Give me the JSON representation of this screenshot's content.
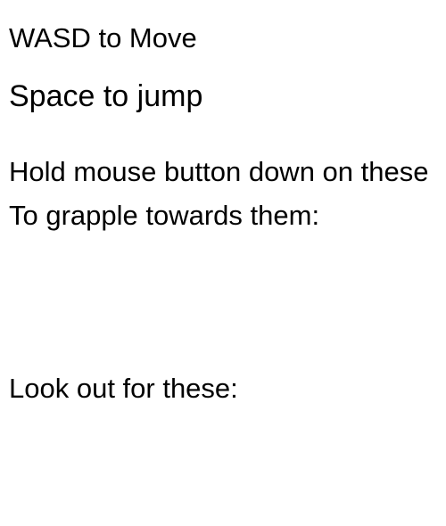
{
  "instructions": {
    "move": "WASD to Move",
    "jump": "Space to jump",
    "grapple": "Hold mouse button down on these To grapple towards them:",
    "hazards": "Look out for these:"
  }
}
